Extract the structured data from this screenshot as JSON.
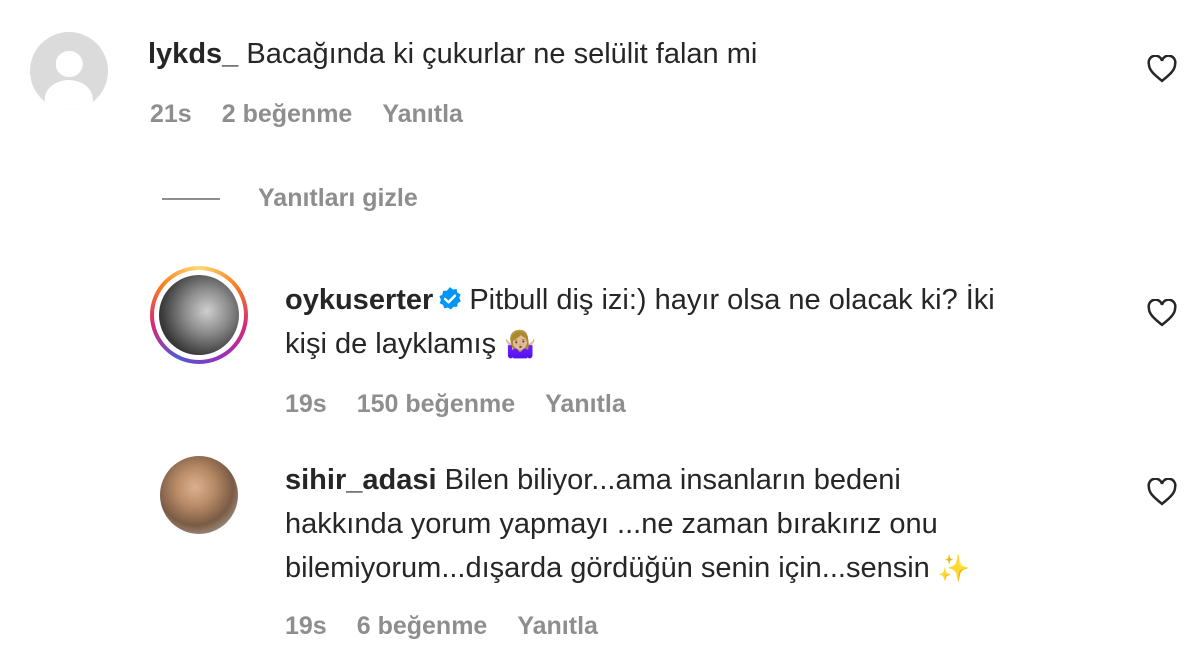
{
  "comments": [
    {
      "username": "lykds_",
      "text": "Bacağında ki çukurlar ne selülit falan mi",
      "time": "21s",
      "likes": "2 beğenme",
      "reply": "Yanıtla",
      "avatar": "default-avatar-icon"
    },
    {
      "username": "oykuserter",
      "verified": true,
      "line1": "Pitbull diş izi:) hayır olsa ne olacak ki? İki",
      "line2": "kişi de layklamış",
      "emoji": "🤷🏼‍♀️",
      "time": "19s",
      "likes": "150 beğenme",
      "reply": "Yanıtla",
      "avatar": "story-ring-avatar"
    },
    {
      "username": "sihir_adasi",
      "line1": "Bilen biliyor...ama insanların bedeni",
      "line2": "hakkında yorum yapmayı ...ne zaman bırakırız onu",
      "line3": "bilemiyorum...dışarda gördüğün senin için...sensin",
      "emoji": "✨",
      "time": "19s",
      "likes": "6 beğenme",
      "reply": "Yanıtla",
      "avatar": "photo-avatar"
    }
  ],
  "hide_replies": "Yanıtları gizle",
  "colors": {
    "text": "#262626",
    "secondary": "#8e8e8e",
    "verified": "#0095f6"
  }
}
